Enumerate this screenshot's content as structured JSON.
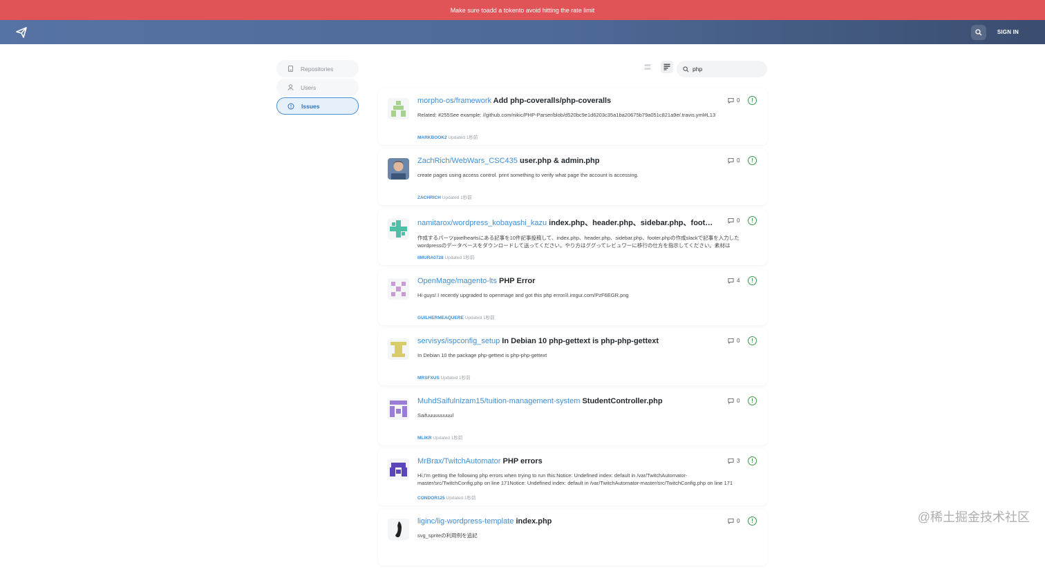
{
  "banner": {
    "text": "Make sure toadd a tokento avoid hitting the rate limit"
  },
  "topbar": {
    "signin_label": "SIGN IN",
    "logo_icon": "paper-plane-icon",
    "search_icon": "search-icon"
  },
  "sidebar": {
    "items": [
      {
        "label": "Repositories",
        "icon": "repo-icon",
        "active": false
      },
      {
        "label": "Users",
        "icon": "user-icon",
        "active": false
      },
      {
        "label": "Issues",
        "icon": "issue-icon",
        "active": true
      }
    ]
  },
  "toolbar": {
    "search_value": "php",
    "view_icons": [
      "grid-view-icon",
      "list-view-icon"
    ]
  },
  "issues": [
    {
      "repo": "morpho-os/framework",
      "title": "Add php-coveralls/php-coveralls",
      "desc": "Related: #255See example: //github.com/nikic/PHP-Parser/blob/d520bc9e1d6203c35a1ba20675b79a051c821a9e/.travis.yml#L13",
      "user": "MARKBOOK2",
      "updated": "Updated 1秒前",
      "comments": "0",
      "avatar_color": "#a7d28c"
    },
    {
      "repo": "ZachRich/WebWars_CSC435",
      "title": "user.php & admin.php",
      "desc": "create pages using access control. print something to verify what page the account is accessing.",
      "user": "ZACHRICH",
      "updated": "Updated 1秒前",
      "comments": "0",
      "avatar_color": "#3b5678"
    },
    {
      "repo": "namitarox/wordpress_kobayashi_kazu",
      "title": "index.php、header.php、sidebar.php、footer.php",
      "desc": "作成するパーツpixelheartsにある記事を10件記事投稿して、index.php、header.php、sidebar.php、footer.phpの作成slackで記事を入力したwordpressのデータベースをダウンロードして送ってください。やり方はググってレビュワーに移行の仕方を指示してください。素材はpixelheartsのものを使用してください。",
      "user": "IIMURA0728",
      "updated": "Updated 1秒前",
      "comments": "0",
      "avatar_color": "#4fbfa8"
    },
    {
      "repo": "OpenMage/magento-lts",
      "title": "PHP Error",
      "desc": "Hi guys! I recently upgraded to openmage and got this php error//i.imgur.com/PzF6EGR.png",
      "user": "GUILHERMEAQUERE",
      "updated": "Updated 1秒前",
      "comments": "4",
      "avatar_color": "#c99ad6"
    },
    {
      "repo": "servisys/ispconfig_setup",
      "title": "In Debian 10 php-gettext is php-php-gettext",
      "desc": "In Debian 10 the package php-gettext is php-php-gettext",
      "user": "MRSFXUS",
      "updated": "Updated 1秒前",
      "comments": "0",
      "avatar_color": "#d8cc6a"
    },
    {
      "repo": "MuhdSaifulnizam15/tuition-management-system",
      "title": "StudentController.php",
      "desc": "Saifuuuuuuuuul",
      "user": "MLIKR",
      "updated": "Updated 1秒前",
      "comments": "0",
      "avatar_color": "#9a7ed6"
    },
    {
      "repo": "MrBrax/TwitchAutomator",
      "title": "PHP errors",
      "desc": "Hi,I'm getting the following php errors when trying to run this:Notice: Undefined index: default in /var/TwitchAutomator-master/src/TwitchConfig.php on line 171Notice: Undefined index: default in /var/TwitchAutomator-master/src/TwitchConfig.php on line 171",
      "user": "CONDOR125",
      "updated": "Updated 1秒前",
      "comments": "3",
      "avatar_color": "#5b45b8"
    },
    {
      "repo": "liginc/lig-wordpress-template",
      "title": "index.php",
      "desc": "svg_spriteの利用例を追記",
      "user": "",
      "updated": "",
      "comments": "0",
      "avatar_color": "#222222"
    }
  ],
  "watermark": "@稀土掘金技术社区"
}
